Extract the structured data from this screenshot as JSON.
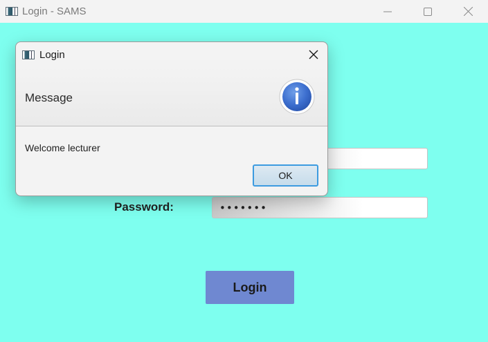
{
  "window": {
    "title": "Login - SAMS",
    "background": "#7effef",
    "controls": [
      "minimize-icon",
      "maximize-icon",
      "close-icon"
    ]
  },
  "form": {
    "password_label": "Password:",
    "username_value": "",
    "password_value": "•••••••",
    "login_label": "Login",
    "login_color": "#6f88d1"
  },
  "dialog": {
    "title": "Login",
    "header": "Message",
    "icon": "info-icon",
    "content": "Welcome lecturer",
    "ok_label": "OK",
    "accent": "#3c9be0"
  }
}
